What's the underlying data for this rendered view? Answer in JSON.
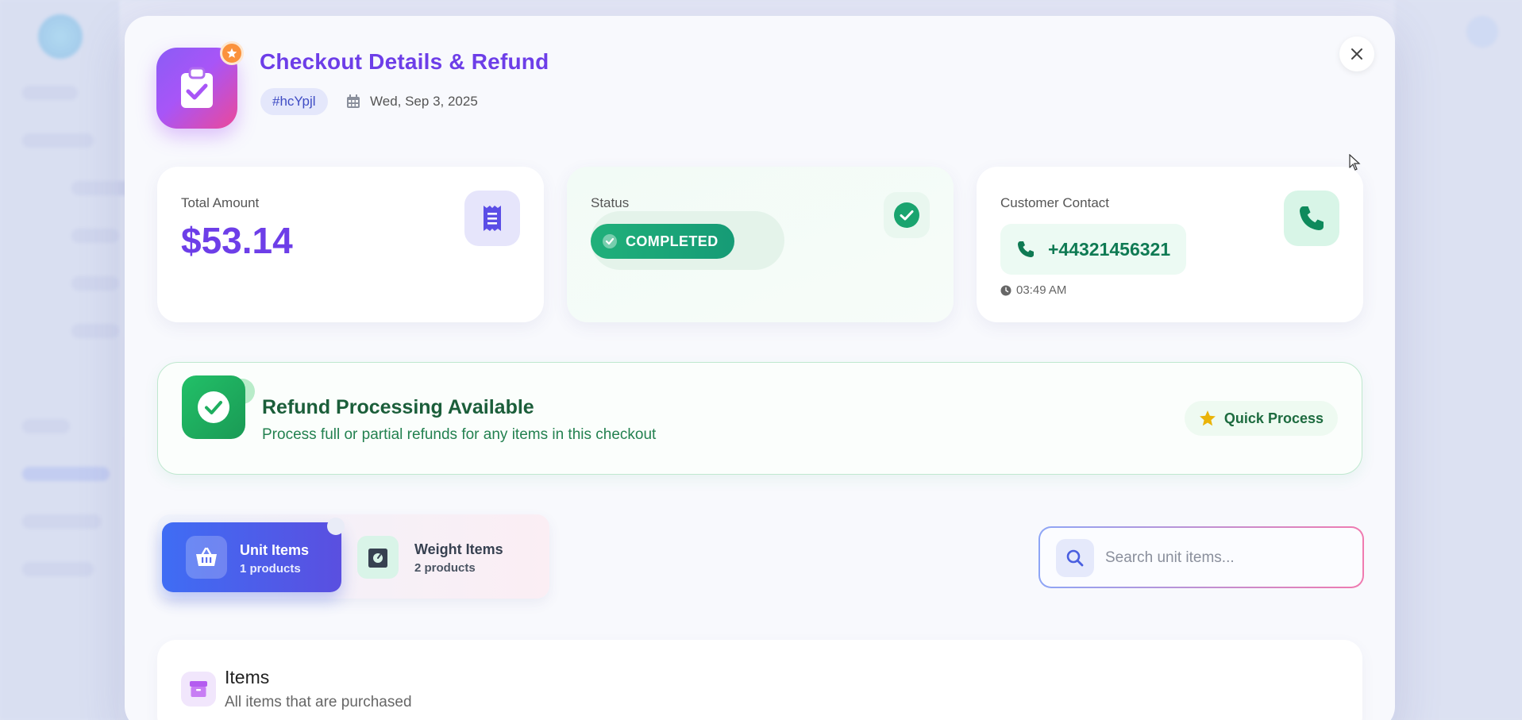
{
  "modal": {
    "title": "Checkout Details & Refund",
    "order_id": "#hcYpjl",
    "date": "Wed, Sep 3, 2025"
  },
  "cards": {
    "total": {
      "label": "Total Amount",
      "value": "$53.14"
    },
    "status": {
      "label": "Status",
      "value": "COMPLETED"
    },
    "contact": {
      "label": "Customer Contact",
      "phone": "+44321456321",
      "time": "03:49 AM"
    }
  },
  "refund": {
    "title": "Refund Processing Available",
    "subtitle": "Process full or partial refunds for any items in this checkout",
    "button": "Quick Process"
  },
  "tabs": [
    {
      "label": "Unit Items",
      "count": "1 products",
      "active": true
    },
    {
      "label": "Weight Items",
      "count": "2 products",
      "active": false
    }
  ],
  "search": {
    "placeholder": "Search unit items..."
  },
  "items": {
    "title": "Items",
    "subtitle": "All items that are purchased"
  },
  "colors": {
    "accent": "#6d3ee8",
    "success": "#169b76",
    "tab_active": "#3f6df4"
  }
}
